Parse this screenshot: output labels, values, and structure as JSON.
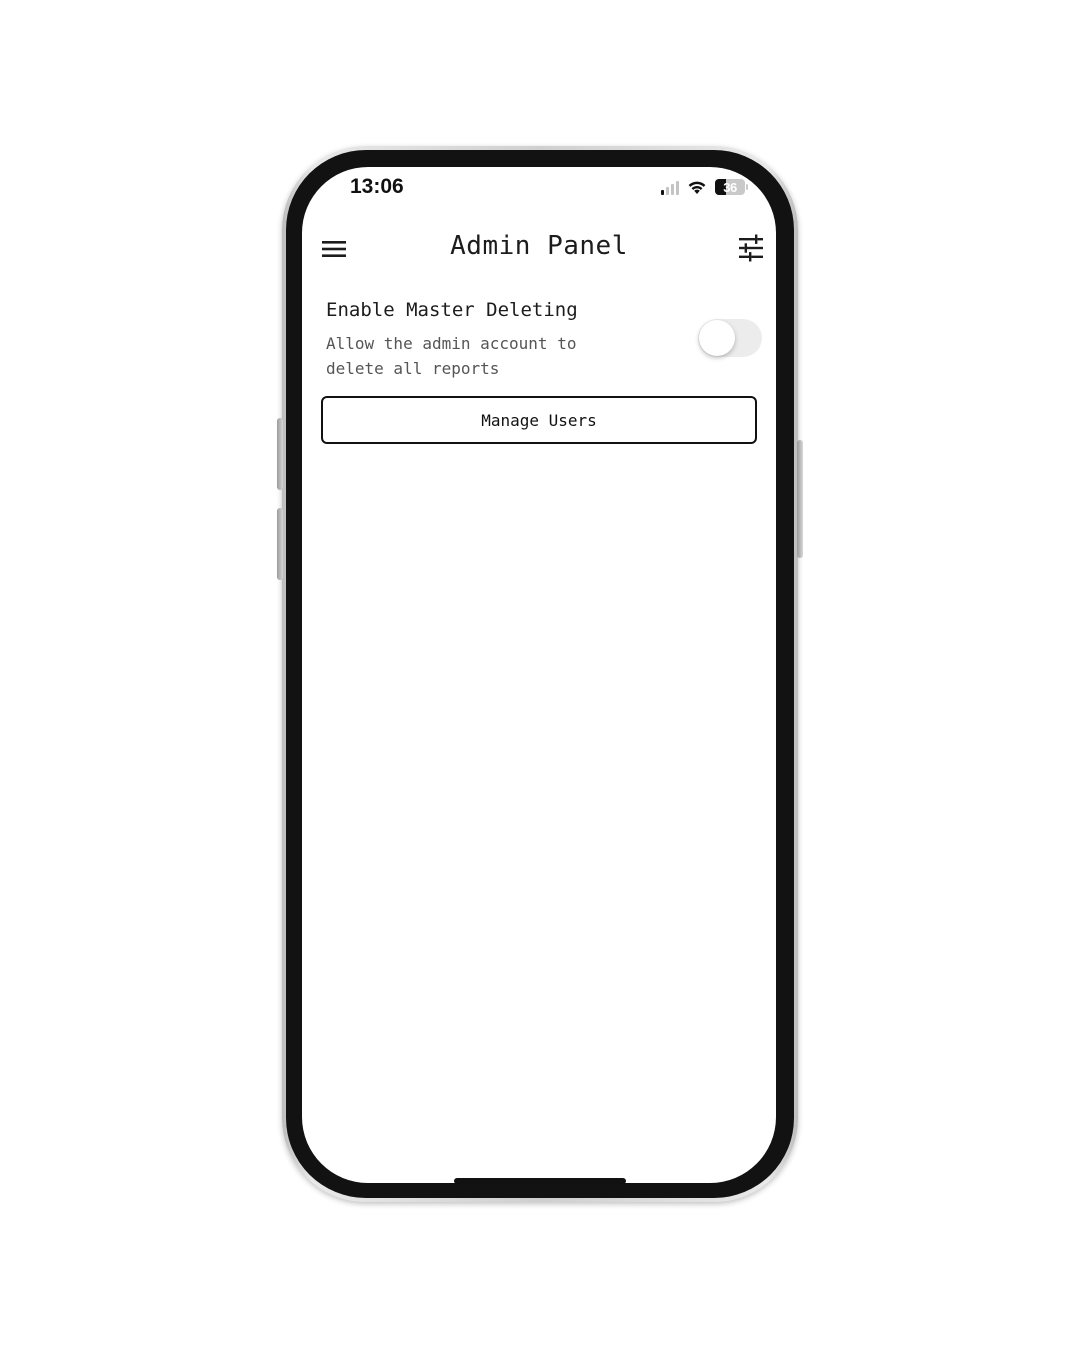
{
  "status_bar": {
    "time": "13:06",
    "battery_percent": 36,
    "battery_label": "36",
    "signal_bars_active": 1,
    "signal_bars_total": 4,
    "wifi": true
  },
  "app_bar": {
    "title": "Admin Panel",
    "left_icon": "menu-icon",
    "right_icon": "tune-icon"
  },
  "settings": {
    "master_deleting": {
      "title": "Enable Master Deleting",
      "description": "Allow the admin account to delete all reports",
      "enabled": false
    }
  },
  "actions": {
    "manage_users_label": "Manage Users"
  },
  "colors": {
    "background": "#ffffff",
    "text_primary": "#1c1c1c",
    "text_secondary": "#555555",
    "toggle_track_off": "#ececec",
    "frame": "#121212"
  }
}
